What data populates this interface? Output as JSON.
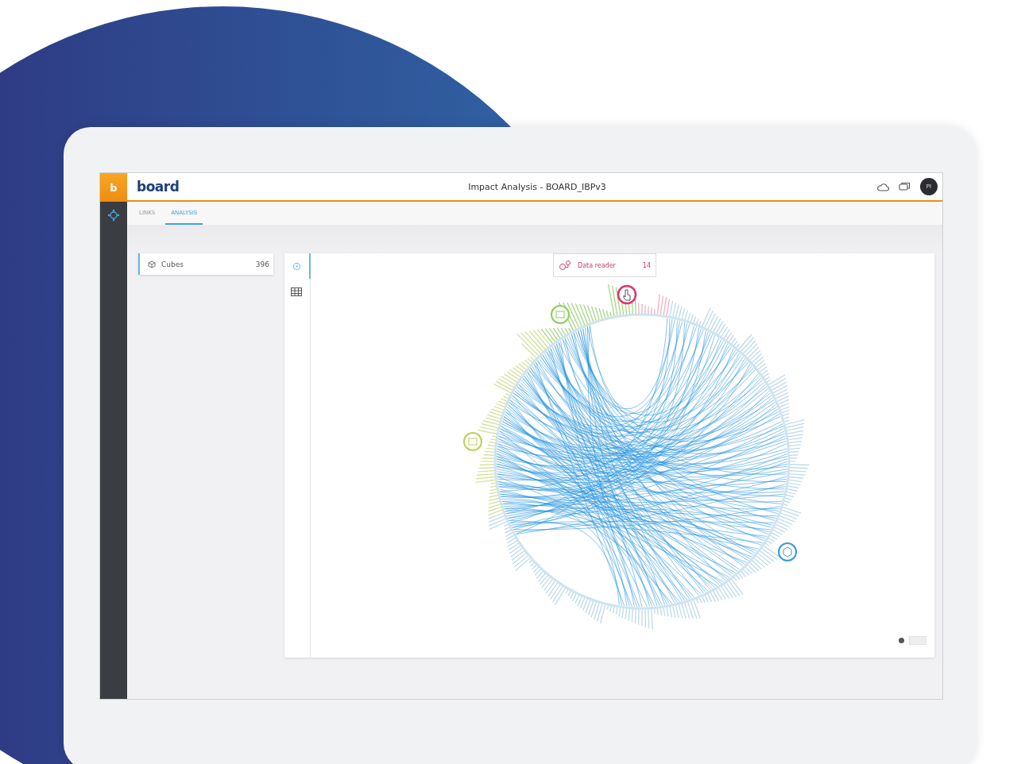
{
  "app": {
    "badge": "b",
    "logo": "board",
    "title": "Impact Analysis - BOARD_IBPv3",
    "avatar": "PI"
  },
  "tabs": [
    {
      "label": "LINKS",
      "selected": false
    },
    {
      "label": "ANALYSIS",
      "selected": true
    }
  ],
  "list": [
    {
      "label": "Cubes",
      "count": "396",
      "selected": true
    }
  ],
  "views": [
    {
      "kind": "diagram",
      "selected": true
    },
    {
      "kind": "table",
      "selected": false
    }
  ],
  "tooltip": {
    "label": "Data reader",
    "count": "14"
  }
}
